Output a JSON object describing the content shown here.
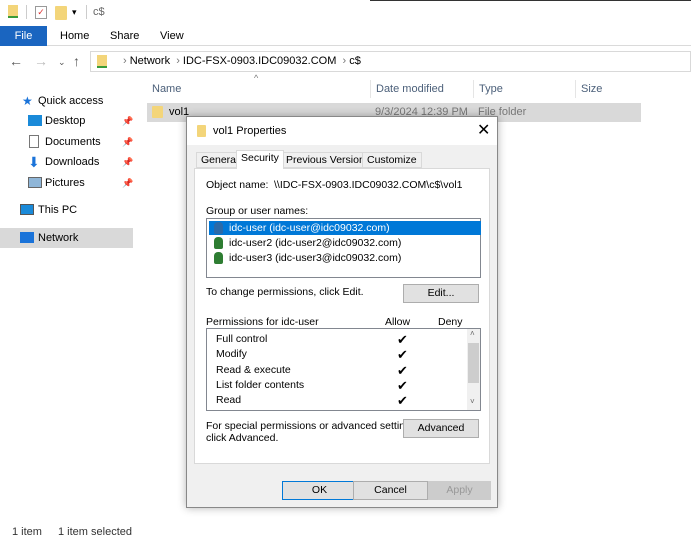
{
  "window": {
    "title": "c$"
  },
  "ribbon": {
    "tabs": [
      "File",
      "Home",
      "Share",
      "View"
    ]
  },
  "address": {
    "segments": [
      "Network",
      "IDC-FSX-0903.IDC09032.COM",
      "c$"
    ]
  },
  "sidebar": {
    "items": [
      {
        "label": "Quick access"
      },
      {
        "label": "Desktop"
      },
      {
        "label": "Documents"
      },
      {
        "label": "Downloads"
      },
      {
        "label": "Pictures"
      },
      {
        "label": "This PC"
      },
      {
        "label": "Network"
      }
    ]
  },
  "columns": [
    "Name",
    "Date modified",
    "Type",
    "Size"
  ],
  "files": [
    {
      "name": "vol1",
      "date": "9/3/2024 12:39 PM",
      "type": "File folder",
      "size": ""
    }
  ],
  "status": {
    "count": "1 item",
    "selected": "1 item selected"
  },
  "dialog": {
    "title": "vol1 Properties",
    "tabs": [
      "General",
      "Security",
      "Previous Versions",
      "Customize"
    ],
    "object_label": "Object name:",
    "object_name": "\\\\IDC-FSX-0903.IDC09032.COM\\c$\\vol1",
    "group_label": "Group or user names:",
    "users": [
      "idc-user (idc-user@idc09032.com)",
      "idc-user2 (idc-user2@idc09032.com)",
      "idc-user3 (idc-user3@idc09032.com)"
    ],
    "change_text": "To change permissions, click Edit.",
    "edit": "Edit...",
    "perm_header": "Permissions for idc-user",
    "allow": "Allow",
    "deny": "Deny",
    "permissions": [
      {
        "name": "Full control",
        "allow": true
      },
      {
        "name": "Modify",
        "allow": true
      },
      {
        "name": "Read & execute",
        "allow": true
      },
      {
        "name": "List folder contents",
        "allow": true
      },
      {
        "name": "Read",
        "allow": true
      }
    ],
    "special_text1": "For special permissions or advanced settings,",
    "special_text2": "click Advanced.",
    "advanced": "Advanced",
    "ok": "OK",
    "cancel": "Cancel",
    "apply": "Apply",
    "check_glyph": "✔"
  }
}
